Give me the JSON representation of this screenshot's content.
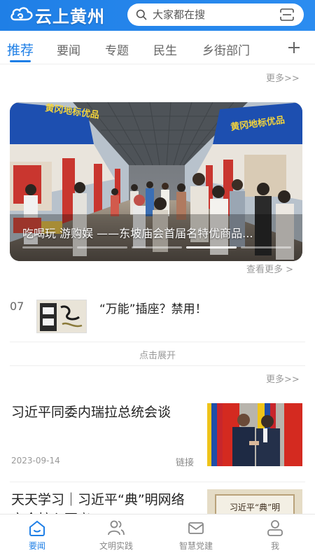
{
  "header": {
    "app_name": "云上黄州",
    "search_placeholder": "大家都在搜",
    "brand_color": "#1f7fe6"
  },
  "tabs": [
    {
      "label": "推荐",
      "active": true
    },
    {
      "label": "要闻",
      "active": false
    },
    {
      "label": "专题",
      "active": false
    },
    {
      "label": "民生",
      "active": false
    },
    {
      "label": "乡街部门",
      "active": false
    }
  ],
  "top_more": "更多>>",
  "banner": {
    "caption": "吃喝玩 游购娱 ——东坡庙会首届名特优商品...",
    "sign_text": "黄冈地标优品",
    "view_more": "查看更多 >",
    "slide_count": 5,
    "active_slide": 4
  },
  "ranked_item": {
    "rank": "07",
    "title": "“万能”插座？禁用！"
  },
  "expand_label": "点击展开",
  "section_more": "更多>>",
  "articles": [
    {
      "title": "习近平同委内瑞拉总统会谈",
      "date": "2023-09-14",
      "tag": "链接"
    },
    {
      "title": "天天学习｜习近平“典”明网络安全核心要义",
      "thumb_text": "习近平“典”明"
    }
  ],
  "bottom_nav": [
    {
      "label": "要闻",
      "icon": "home-icon",
      "active": true
    },
    {
      "label": "文明实践",
      "icon": "people-icon",
      "active": false
    },
    {
      "label": "智慧党建",
      "icon": "mail-icon",
      "active": false
    },
    {
      "label": "我",
      "icon": "user-icon",
      "active": false
    }
  ]
}
